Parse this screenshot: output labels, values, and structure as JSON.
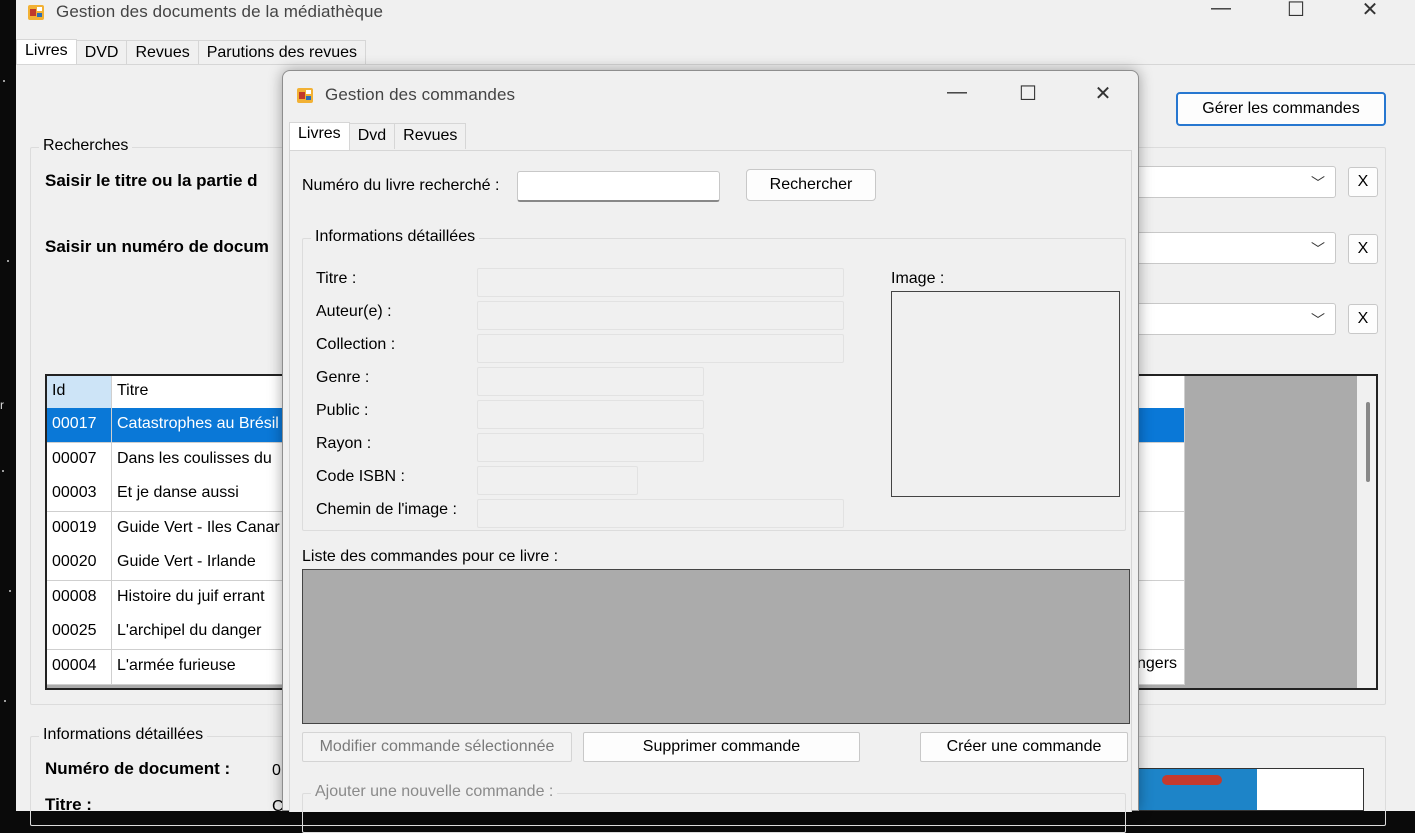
{
  "main": {
    "title": "Gestion des documents de la médiathèque",
    "tabs": [
      "Livres",
      "DVD",
      "Revues",
      "Parutions des revues"
    ],
    "manage_orders_button": "Gérer les commandes",
    "search_group_title": "Recherches",
    "search_title_label": "Saisir le titre ou la partie d",
    "search_number_label": "Saisir un numéro de docum",
    "clear_label": "X",
    "grid": {
      "headers": [
        "Id",
        "Titre"
      ],
      "rows": [
        {
          "id": "00017",
          "title": "Catastrophes au Brésil",
          "selected": true
        },
        {
          "id": "00007",
          "title": "Dans les coulisses du"
        },
        {
          "id": "00003",
          "title": "Et je danse aussi"
        },
        {
          "id": "00019",
          "title": "Guide Vert - Iles Canar"
        },
        {
          "id": "00020",
          "title": "Guide Vert - Irlande"
        },
        {
          "id": "00008",
          "title": "Histoire du juif errant"
        },
        {
          "id": "00025",
          "title": "L'archipel du danger"
        },
        {
          "id": "00004",
          "title": "L'armée furieuse"
        }
      ],
      "partial_right_text": "ngers"
    },
    "detail_group_title": "Informations détaillées",
    "doc_number_label": "Numéro de document :",
    "doc_number_value": "0",
    "title_label": "Titre :",
    "title_value": "C"
  },
  "dialog": {
    "title": "Gestion des commandes",
    "tabs": [
      "Livres",
      "Dvd",
      "Revues"
    ],
    "search_label": "Numéro du livre recherché :",
    "search_value": "",
    "search_button": "Rechercher",
    "details_group_title": "Informations détaillées",
    "fields": [
      {
        "label": "Titre :",
        "value": ""
      },
      {
        "label": "Auteur(e) :",
        "value": ""
      },
      {
        "label": "Collection :",
        "value": ""
      },
      {
        "label": "Genre :",
        "value": ""
      },
      {
        "label": "Public :",
        "value": ""
      },
      {
        "label": "Rayon :",
        "value": ""
      },
      {
        "label": "Code ISBN :",
        "value": ""
      },
      {
        "label": "Chemin de l'image :",
        "value": ""
      }
    ],
    "image_label": "Image :",
    "orders_list_label": "Liste des commandes pour ce livre :",
    "modify_button": "Modifier commande sélectionnée",
    "delete_button": "Supprimer commande",
    "create_button": "Créer une commande",
    "new_order_group_title": "Ajouter une nouvelle commande :"
  },
  "window_controls": {
    "minimize": "—",
    "maximize": "☐",
    "close": "✕"
  }
}
